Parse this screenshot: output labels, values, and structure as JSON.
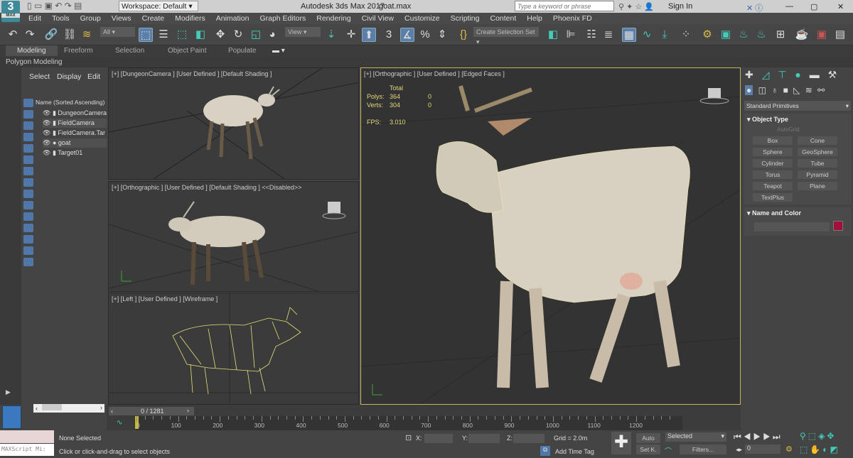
{
  "app": {
    "title": "Autodesk 3ds Max 2017",
    "file": "goat.max",
    "logo": "3",
    "logo_sub": "MAX",
    "workspace": "Workspace: Default",
    "search_placeholder": "Type a keyword or phrase",
    "sign_in": "Sign In"
  },
  "menu": [
    "Edit",
    "Tools",
    "Group",
    "Views",
    "Create",
    "Modifiers",
    "Animation",
    "Graph Editors",
    "Rendering",
    "Civil View",
    "Customize",
    "Scripting",
    "Content",
    "Help",
    "Phoenix FD"
  ],
  "toolbar": {
    "filter": "All",
    "ref_coord": "View",
    "selection_set": "Create Selection Set",
    "snap_label": "3",
    "percent": "%"
  },
  "ribbon": {
    "tabs": [
      "Modeling",
      "Freeform",
      "Selection",
      "Object Paint",
      "Populate"
    ],
    "active": "Modeling",
    "sub": "Polygon Modeling"
  },
  "explorer": {
    "menu": [
      "Select",
      "Display",
      "Edit"
    ],
    "header": "Name (Sorted Ascending)",
    "items": [
      {
        "name": "DungeonCamera",
        "type": "camera"
      },
      {
        "name": "FieldCamera",
        "type": "camera",
        "selected": true
      },
      {
        "name": "FieldCamera.Tar",
        "type": "camera"
      },
      {
        "name": "goat",
        "type": "geometry",
        "selected": true
      },
      {
        "name": "Target01",
        "type": "camera"
      }
    ]
  },
  "viewports": {
    "top_left": "[+] [DungeonCamera ] [User Defined ] [Default Shading ]",
    "mid_left": "[+] [Orthographic ] [User Defined ] [Default Shading ]  <<Disabled>>",
    "bottom_left": "[+] [Left ] [User Defined ] [Wireframe ]",
    "main": "[+] [Orthographic ] [User Defined ] [Edged Faces ]"
  },
  "stats": {
    "total_label": "Total",
    "polys_label": "Polys:",
    "polys": "364",
    "polys_sel": "0",
    "verts_label": "Verts:",
    "verts": "304",
    "verts_sel": "0",
    "fps_label": "FPS:",
    "fps": "3.010"
  },
  "command_panel": {
    "category": "Standard Primitives",
    "object_type": "Object Type",
    "autogrid": "AutoGrid",
    "buttons": [
      "Box",
      "Cone",
      "Sphere",
      "GeoSphere",
      "Cylinder",
      "Tube",
      "Torus",
      "Pyramid",
      "Teapot",
      "Plane",
      "TextPlus"
    ],
    "name_color": "Name and Color",
    "color": "#a0103a"
  },
  "timeline": {
    "frame": "0 / 1281",
    "ticks": [
      "0",
      "100",
      "200",
      "300",
      "400",
      "500",
      "600",
      "700",
      "800",
      "900",
      "1000",
      "1100",
      "1200"
    ]
  },
  "status": {
    "selection": "None Selected",
    "prompt": "Click or click-and-drag to select objects",
    "maxscript": "MAXScript Mi:",
    "x_label": "X:",
    "y_label": "Y:",
    "z_label": "Z:",
    "grid": "Grid = 2.0m",
    "add_time_tag": "Add Time Tag",
    "auto": "Auto",
    "set_key": "Set K.",
    "key_filter": "Selected",
    "filters": "Filters...",
    "frame_value": "0"
  }
}
